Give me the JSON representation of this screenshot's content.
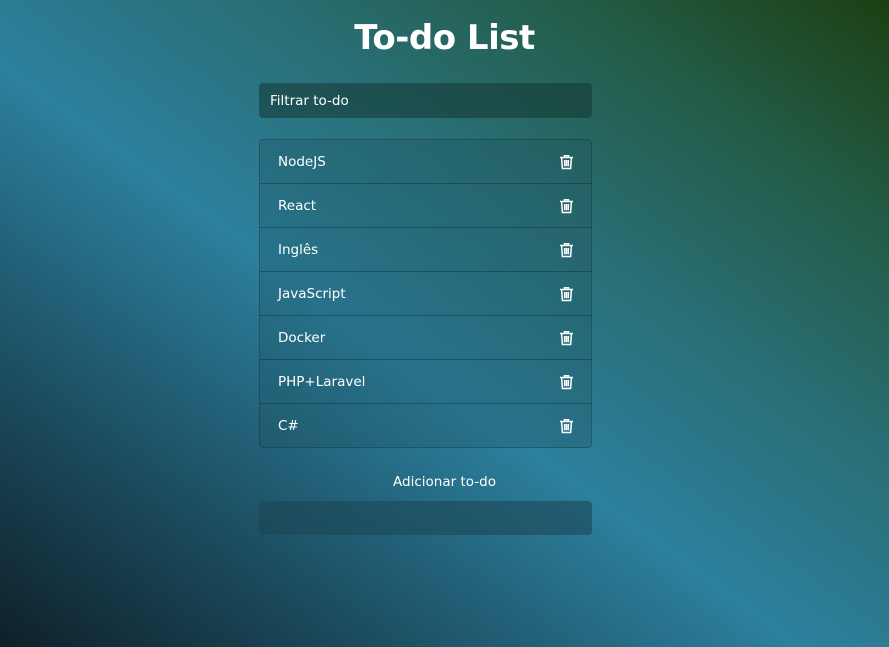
{
  "page": {
    "title": "To-do List"
  },
  "filter": {
    "placeholder": "Filtrar to-do",
    "value": ""
  },
  "todos": [
    {
      "label": "NodeJS",
      "icon": "trash-icon"
    },
    {
      "label": "React",
      "icon": "trash-icon"
    },
    {
      "label": "Inglês",
      "icon": "trash-icon"
    },
    {
      "label": "JavaScript",
      "icon": "trash-icon"
    },
    {
      "label": "Docker",
      "icon": "trash-icon"
    },
    {
      "label": "PHP+Laravel",
      "icon": "trash-icon"
    },
    {
      "label": "C#",
      "icon": "trash-icon"
    }
  ],
  "add": {
    "label": "Adicionar to-do",
    "value": ""
  },
  "colors": {
    "text": "#ffffff",
    "gradient_dark": "#0e2029",
    "gradient_mid": "#2c809e",
    "gradient_green": "#1c3f12"
  }
}
